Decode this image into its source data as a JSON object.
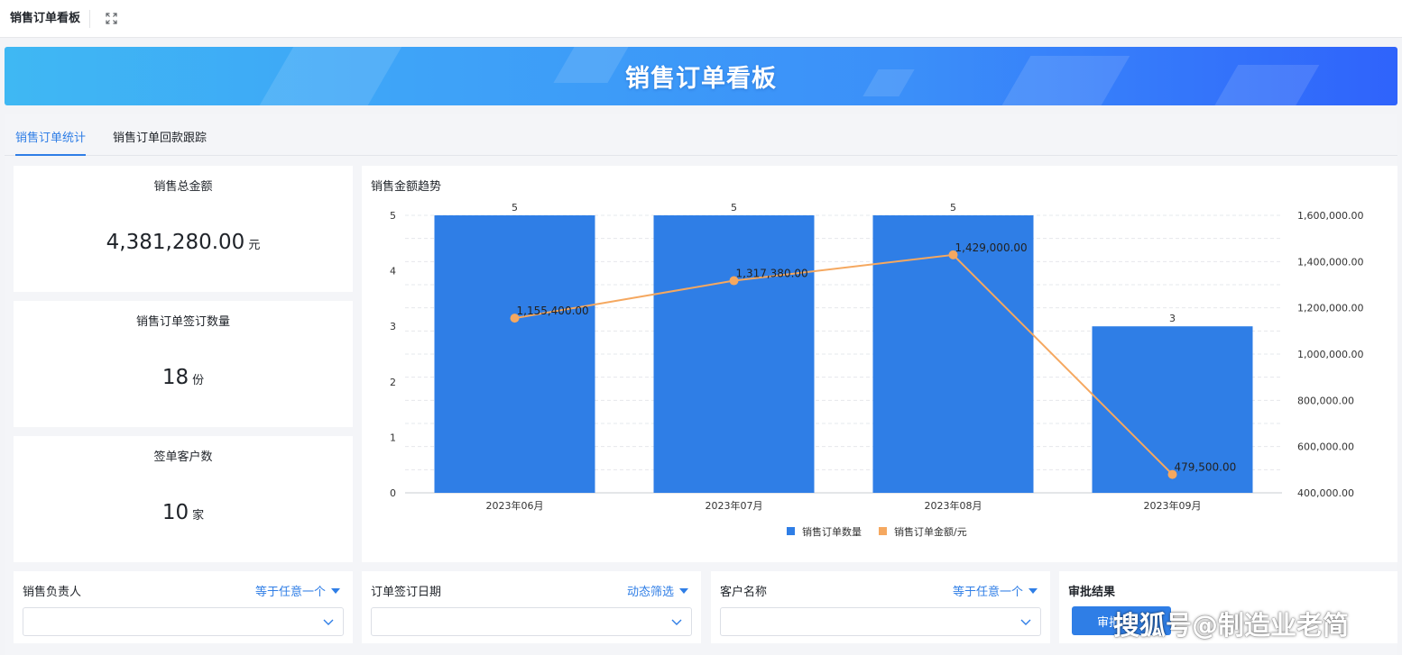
{
  "app": {
    "title": "销售订单看板"
  },
  "banner": {
    "title": "销售订单看板"
  },
  "tabs": [
    {
      "label": "销售订单统计",
      "active": true
    },
    {
      "label": "销售订单回款跟踪",
      "active": false
    }
  ],
  "kpis": [
    {
      "label": "销售总金额",
      "value": "4,381,280.00",
      "unit": "元"
    },
    {
      "label": "销售订单签订数量",
      "value": "18",
      "unit": "份"
    },
    {
      "label": "签单客户数",
      "value": "10",
      "unit": "家"
    }
  ],
  "chart_card": {
    "title": "销售金额趋势"
  },
  "chart_data": {
    "type": "bar",
    "title": "销售金额趋势",
    "categories": [
      "2023年06月",
      "2023年07月",
      "2023年08月",
      "2023年09月"
    ],
    "series": [
      {
        "name": "销售订单数量",
        "type": "bar",
        "axis": "left",
        "values": [
          5,
          5,
          5,
          3
        ],
        "labels": [
          "5",
          "5",
          "5",
          "3"
        ],
        "color": "#2f7ee6"
      },
      {
        "name": "销售订单金额/元",
        "type": "line",
        "axis": "right",
        "values": [
          1155400,
          1317380,
          1429000,
          479500
        ],
        "labels": [
          "1,155,400.00",
          "1,317,380.00",
          "1,429,000.00",
          "479,500.00"
        ],
        "color": "#f5a860"
      }
    ],
    "left_axis": {
      "ylim": [
        0,
        5
      ],
      "ticks": [
        "0",
        "1",
        "2",
        "3",
        "4",
        "5"
      ]
    },
    "right_axis": {
      "ylim": [
        400000,
        1600000
      ],
      "ticks": [
        "400,000.00",
        "600,000.00",
        "800,000.00",
        "1,000,000.00",
        "1,200,000.00",
        "1,400,000.00",
        "1,600,000.00"
      ]
    },
    "grid": true,
    "legend": "bottom-center"
  },
  "filters": [
    {
      "label": "销售负责人",
      "mode": "等于任意一个",
      "value": ""
    },
    {
      "label": "订单签订日期",
      "mode": "动态筛选",
      "value": ""
    },
    {
      "label": "客户名称",
      "mode": "等于任意一个",
      "value": ""
    }
  ],
  "approval": {
    "label": "审批结果",
    "button": "审批"
  },
  "watermark": "搜狐号@制造业老简",
  "colors": {
    "accent": "#2f7ee6",
    "line": "#f5a860"
  }
}
